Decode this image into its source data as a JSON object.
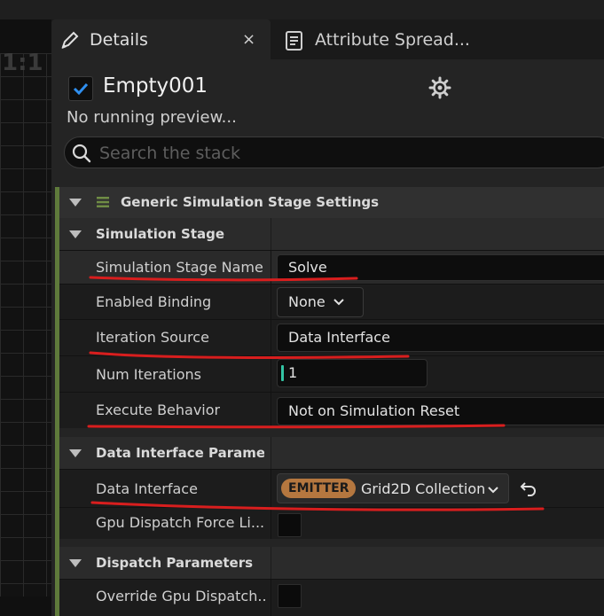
{
  "viewport": {
    "ratio_label": "1:1"
  },
  "tabs": {
    "details": {
      "label": "Details",
      "close": "×"
    },
    "attribute_spreadsheet": {
      "label": "Attribute Spread..."
    }
  },
  "emitter": {
    "name": "Empty001",
    "enabled": true,
    "preview_status": "No running preview..."
  },
  "search": {
    "placeholder": "Search the stack",
    "value": ""
  },
  "stack": {
    "section_title": "Generic Simulation Stage Settings",
    "categories": {
      "simulation_stage": {
        "title": "Simulation Stage"
      },
      "data_interface_params": {
        "title": "Data Interface Paramete"
      },
      "dispatch_params": {
        "title": "Dispatch Parameters"
      }
    },
    "properties": {
      "stage_name": {
        "label": "Simulation Stage Name",
        "value": "Solve"
      },
      "enabled_binding": {
        "label": "Enabled Binding",
        "value": "None"
      },
      "iteration_source": {
        "label": "Iteration Source",
        "value": "Data Interface"
      },
      "num_iterations": {
        "label": "Num Iterations",
        "value": "1"
      },
      "execute_behavior": {
        "label": "Execute Behavior",
        "value": "Not on Simulation Reset"
      },
      "data_interface": {
        "label": "Data Interface",
        "badge": "EMITTER",
        "value": "Grid2D Collection"
      },
      "gpu_dispatch_force": {
        "label": "Gpu Dispatch Force Li..."
      },
      "override_gpu_dispatch": {
        "label": "Override Gpu Dispatch..."
      }
    }
  },
  "colors": {
    "accent_green": "#5f7a3b",
    "checkbox_blue": "#2f8ff0",
    "emitter_badge": "#b5773f",
    "annotation_red": "#d81e1e"
  }
}
